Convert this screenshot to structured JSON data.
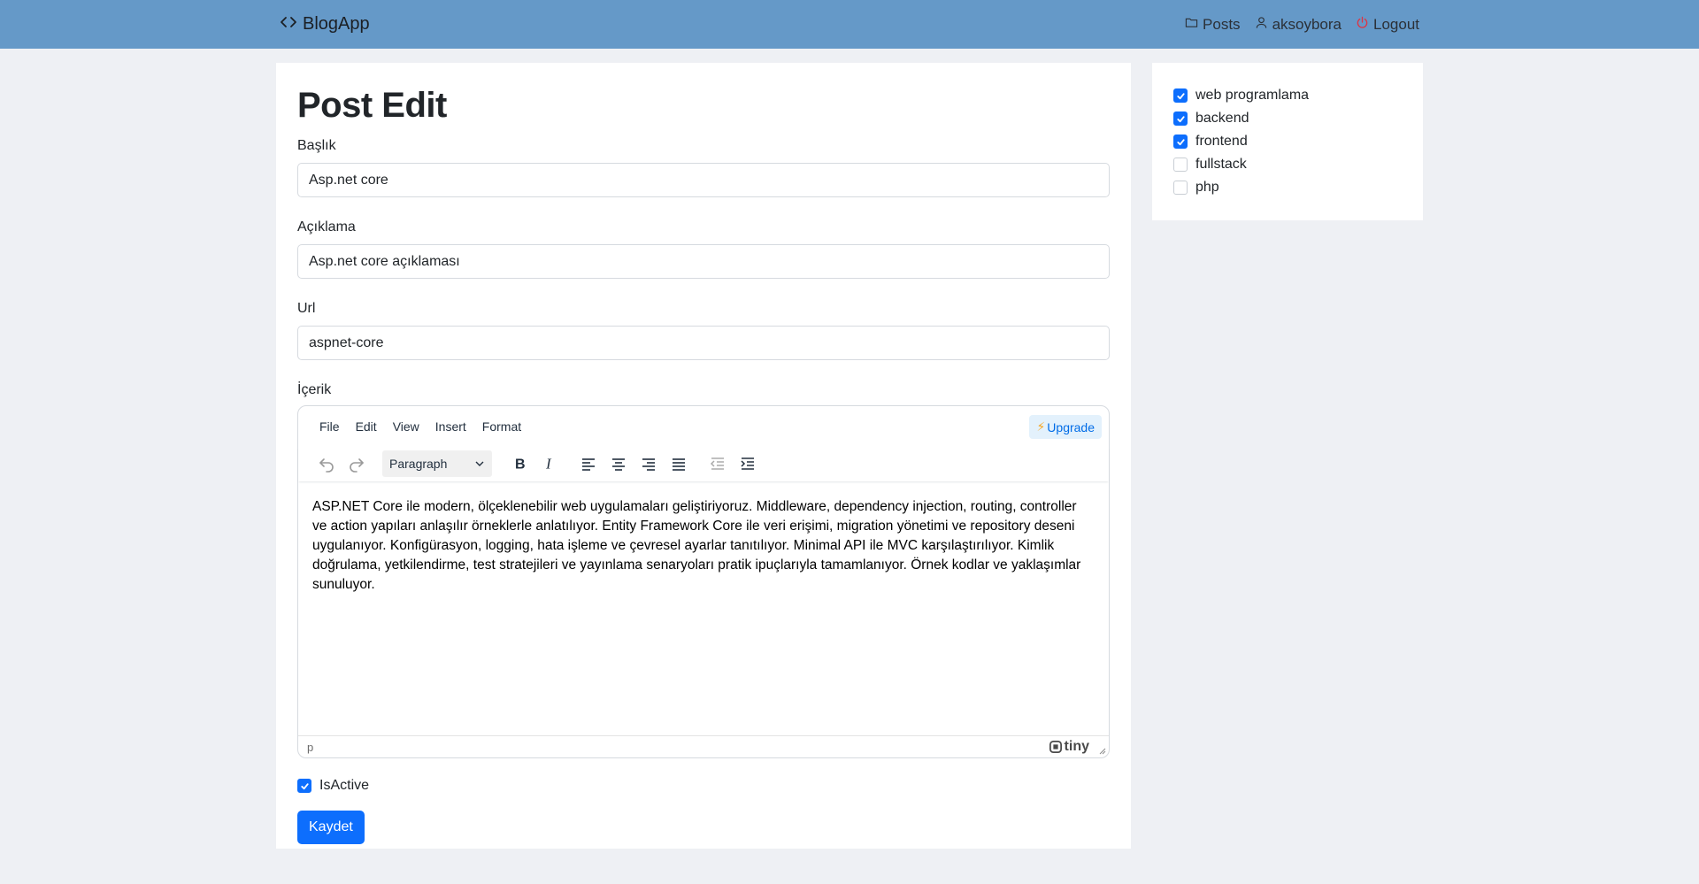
{
  "navbar": {
    "brand": "BlogApp",
    "links": {
      "posts": "Posts",
      "user": "aksoybora",
      "logout": "Logout"
    }
  },
  "page": {
    "title": "Post Edit"
  },
  "form": {
    "title_label": "Başlık",
    "title_value": "Asp.net core",
    "description_label": "Açıklama",
    "description_value": "Asp.net core açıklaması",
    "url_label": "Url",
    "url_value": "aspnet-core",
    "content_label": "İçerik",
    "is_active_label": "IsActive",
    "is_active": true,
    "save_label": "Kaydet"
  },
  "editor": {
    "menu": {
      "file": "File",
      "edit": "Edit",
      "view": "View",
      "insert": "Insert",
      "format": "Format"
    },
    "upgrade_label": "Upgrade",
    "block_format": "Paragraph",
    "content": "ASP.NET Core ile modern, ölçeklenebilir web uygulamaları geliştiriyoruz. Middleware, dependency injection, routing, controller ve action yapıları anlaşılır örneklerle anlatılıyor. Entity Framework Core ile veri erişimi, migration yönetimi ve repository deseni uygulanıyor. Konfigürasyon, logging, hata işleme ve çevresel ayarlar tanıtılıyor. Minimal API ile MVC karşılaştırılıyor. Kimlik doğrulama, yetkilendirme, test stratejileri ve yayınlama senaryoları pratik ipuçlarıyla tamamlanıyor. Örnek kodlar ve yaklaşımlar sunuluyor.",
    "status_path": "p",
    "brand": "tiny"
  },
  "categories": [
    {
      "label": "web programlama",
      "checked": true
    },
    {
      "label": "backend",
      "checked": true
    },
    {
      "label": "frontend",
      "checked": true
    },
    {
      "label": "fullstack",
      "checked": false
    },
    {
      "label": "php",
      "checked": false
    }
  ],
  "colors": {
    "navbar": "#6599c8",
    "primary": "#0d6efd",
    "background": "#eef0f4"
  }
}
